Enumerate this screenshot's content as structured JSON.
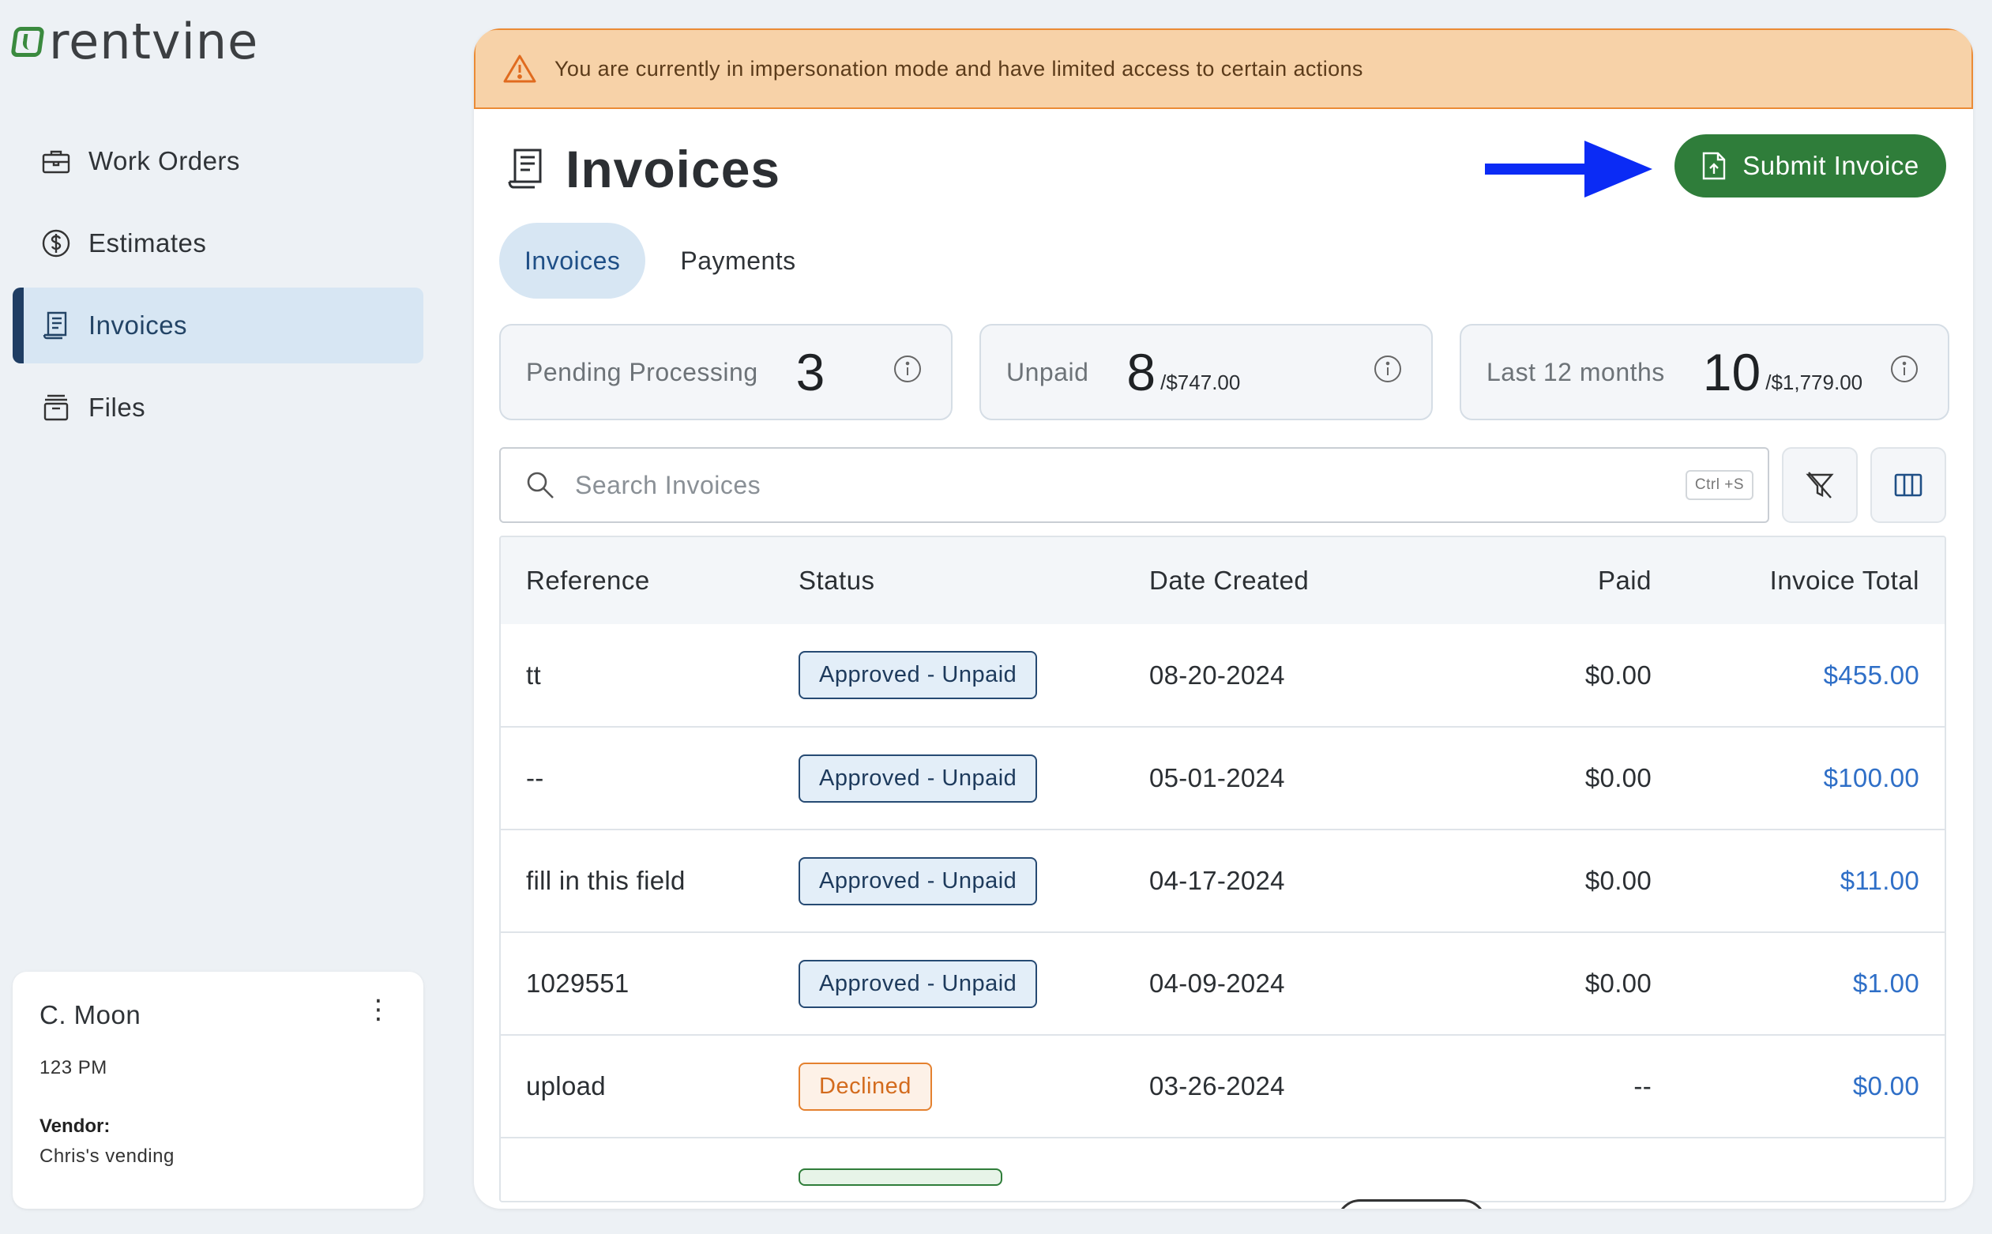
{
  "brand": {
    "name": "rentvine"
  },
  "nav": {
    "items": [
      {
        "label": "Work Orders",
        "icon": "briefcase-icon"
      },
      {
        "label": "Estimates",
        "icon": "dollar-circle-icon"
      },
      {
        "label": "Invoices",
        "icon": "receipt-icon",
        "active": true
      },
      {
        "label": "Files",
        "icon": "archive-icon"
      }
    ]
  },
  "user": {
    "name": "C. Moon",
    "time": "123 PM",
    "vendor_label": "Vendor:",
    "vendor_name": "Chris's vending"
  },
  "banner": {
    "text": "You are currently in impersonation mode and have limited access to certain actions",
    "color": "#f7d2a8"
  },
  "page": {
    "title": "Invoices",
    "submit_label": "Submit Invoice",
    "accent": "#2f7d3a"
  },
  "tabs": [
    {
      "label": "Invoices",
      "active": true
    },
    {
      "label": "Payments",
      "active": false
    }
  ],
  "stats": [
    {
      "label": "Pending Processing",
      "count": "3",
      "amount": ""
    },
    {
      "label": "Unpaid",
      "count": "8",
      "amount": "/$747.00"
    },
    {
      "label": "Last 12 months",
      "count": "10",
      "amount": "/$1,779.00"
    }
  ],
  "search": {
    "placeholder": "Search Invoices",
    "shortcut": "Ctrl +S"
  },
  "table": {
    "headers": [
      "Reference",
      "Status",
      "Date Created",
      "Paid",
      "Invoice Total"
    ],
    "rows": [
      {
        "reference": "tt",
        "status": "Approved - Unpaid",
        "status_type": "approved",
        "date": "08-20-2024",
        "paid": "$0.00",
        "total": "$455.00"
      },
      {
        "reference": "--",
        "status": "Approved - Unpaid",
        "status_type": "approved",
        "date": "05-01-2024",
        "paid": "$0.00",
        "total": "$100.00"
      },
      {
        "reference": "fill in this field",
        "status": "Approved - Unpaid",
        "status_type": "approved",
        "date": "04-17-2024",
        "paid": "$0.00",
        "total": "$11.00"
      },
      {
        "reference": "1029551",
        "status": "Approved - Unpaid",
        "status_type": "approved",
        "date": "04-09-2024",
        "paid": "$0.00",
        "total": "$1.00"
      },
      {
        "reference": "upload",
        "status": "Declined",
        "status_type": "declined",
        "date": "03-26-2024",
        "paid": "--",
        "total": "$0.00"
      }
    ]
  }
}
